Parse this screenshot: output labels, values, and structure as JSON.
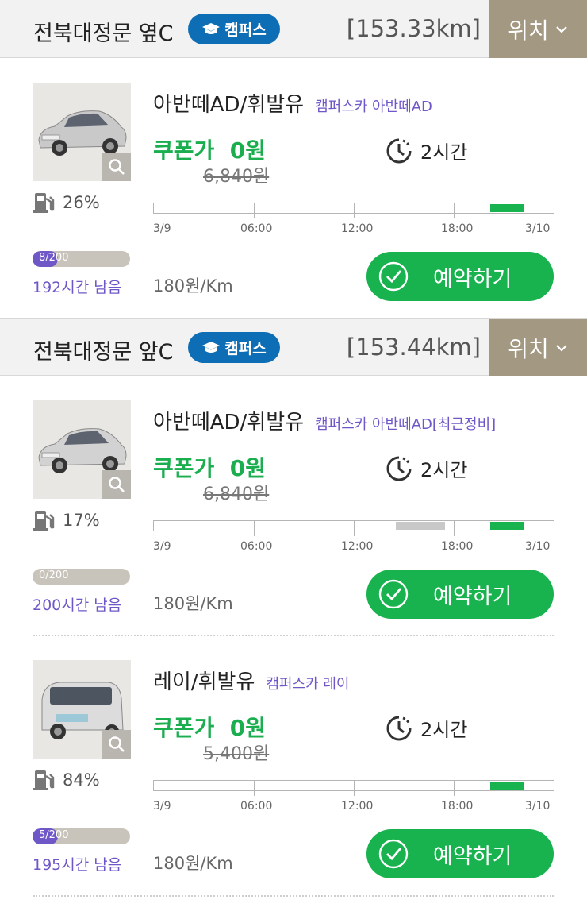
{
  "sections": [
    {
      "location": "전북대정문 옆C",
      "badge": "캠퍼스",
      "distance": "[153.33km]",
      "location_button": "위치",
      "cars": [
        {
          "model": "아반떼AD/휘발유",
          "subtitle": "캠퍼스카 아반떼AD",
          "coupon_label": "쿠폰가",
          "coupon_price": "0원",
          "original_price": "6,840원",
          "duration": "2시간",
          "fuel": "26%",
          "hours_used": "8/200",
          "hours_used_fraction": 0.04,
          "hours_remaining": "192시간 남음",
          "price_per_km": "180원/Km",
          "reserve_label": "예약하기",
          "timeline_labels": [
            "3/9",
            "06:00",
            "12:00",
            "18:00",
            "3/10"
          ]
        }
      ]
    },
    {
      "location": "전북대정문 앞C",
      "badge": "캠퍼스",
      "distance": "[153.44km]",
      "location_button": "위치",
      "cars": [
        {
          "model": "아반떼AD/휘발유",
          "subtitle": "캠퍼스카 아반떼AD[최근정비]",
          "coupon_label": "쿠폰가",
          "coupon_price": "0원",
          "original_price": "6,840원",
          "duration": "2시간",
          "fuel": "17%",
          "hours_used": "0/200",
          "hours_used_fraction": 0,
          "hours_remaining": "200시간 남음",
          "price_per_km": "180원/Km",
          "reserve_label": "예약하기",
          "timeline_labels": [
            "3/9",
            "06:00",
            "12:00",
            "18:00",
            "3/10"
          ]
        },
        {
          "model": "레이/휘발유",
          "subtitle": "캠퍼스카 레이",
          "coupon_label": "쿠폰가",
          "coupon_price": "0원",
          "original_price": "5,400원",
          "duration": "2시간",
          "fuel": "84%",
          "hours_used": "5/200",
          "hours_used_fraction": 0.025,
          "hours_remaining": "195시간 남음",
          "price_per_km": "180원/Km",
          "reserve_label": "예약하기",
          "timeline_labels": [
            "3/9",
            "06:00",
            "12:00",
            "18:00",
            "3/10"
          ]
        }
      ]
    }
  ],
  "colors": {
    "accent_green": "#18b24e",
    "campus_badge": "#0e6eb5",
    "location_button": "#a39882",
    "purple": "#6f57c8",
    "timeline_available": "#18b24e",
    "timeline_booked": "#c8c8c8"
  },
  "icons": [
    "graduation-cap-icon",
    "chevron-down-icon",
    "search-icon",
    "fuel-pump-icon",
    "clock-icon",
    "check-circle-icon"
  ]
}
